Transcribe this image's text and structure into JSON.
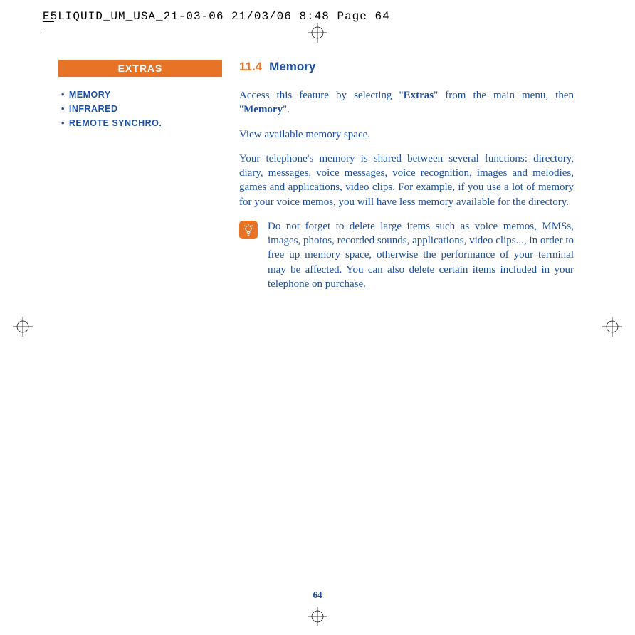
{
  "header": {
    "crop_info": "E5LIQUID_UM_USA_21-03-06  21/03/06  8:48  Page 64"
  },
  "sidebar": {
    "title": "EXTRAS",
    "items": [
      "MEMORY",
      "INFRARED",
      "REMOTE SYNCHRO."
    ]
  },
  "section": {
    "number": "11.4",
    "title": "Memory"
  },
  "content": {
    "access_pre": "Access this feature by selecting \"",
    "access_bold1": "Extras",
    "access_mid": "\" from the main menu, then \"",
    "access_bold2": "Memory",
    "access_post": "\".",
    "view_line": "View available memory space.",
    "shared_para": "Your telephone's memory is shared between several functions: directory, diary, messages, voice messages, voice recognition, images and melodies, games and applications, video clips. For example, if you use a lot of memory for your voice memos, you will have less memory available for the directory.",
    "tip_text": "Do not forget to delete large items such as voice memos, MMSs, images, photos, recorded sounds, applications, video clips..., in order to free up memory space, otherwise the performance of your terminal may be affected. You can also delete certain items included in your telephone on purchase."
  },
  "page_number": "64"
}
